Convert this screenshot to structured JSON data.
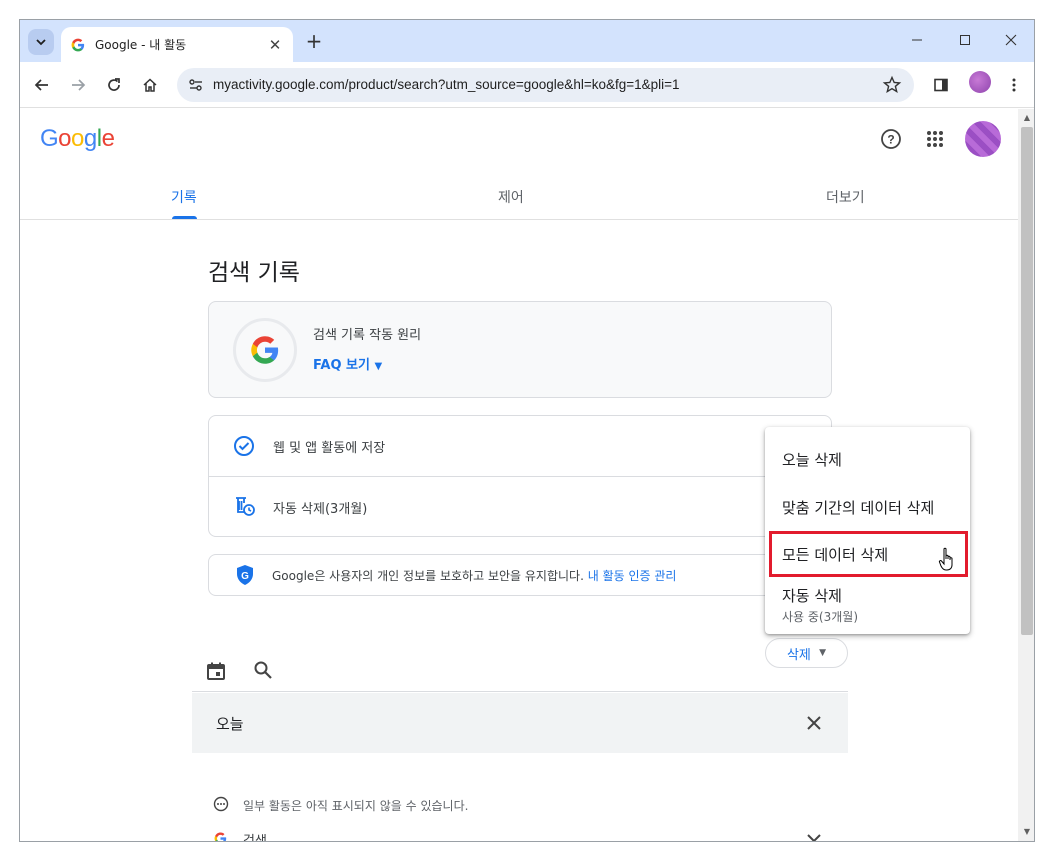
{
  "browser": {
    "tab_title": "Google - 내 활동",
    "new_tab": "+",
    "url": "myactivity.google.com/product/search?utm_source=google&hl=ko&fg=1&pli=1"
  },
  "header": {
    "logo": "Google",
    "nav": [
      {
        "label": "기록",
        "active": true
      },
      {
        "label": "제어",
        "active": false
      },
      {
        "label": "더보기",
        "active": false
      }
    ]
  },
  "main": {
    "title": "검색 기록",
    "info_card": {
      "heading": "검색 기록 작동 원리",
      "faq_link": "FAQ 보기"
    },
    "settings": {
      "save_label": "웹 및 앱 활동에 저장",
      "auto_delete_label": "자동 삭제(3개월)"
    },
    "privacy": {
      "text": "Google은 사용자의 개인 정보를 보호하고 보안을 유지합니다.",
      "link": "내 활동 인증 관리"
    },
    "delete_button": "삭제",
    "today_label": "오늘",
    "notice": "일부 활동은 아직 표시되지 않을 수 있습니다.",
    "search_item": "검색"
  },
  "menu": {
    "items": [
      {
        "label": "오늘 삭제"
      },
      {
        "label": "맞춤 기간의 데이터 삭제"
      },
      {
        "label": "모든 데이터 삭제",
        "highlighted": true
      },
      {
        "label": "자동 삭제",
        "sublabel": "사용 중(3개월)"
      }
    ]
  },
  "colors": {
    "accent": "#1a73e8",
    "highlight_border": "#e21b2d",
    "titlebar": "#d3e3fd"
  }
}
